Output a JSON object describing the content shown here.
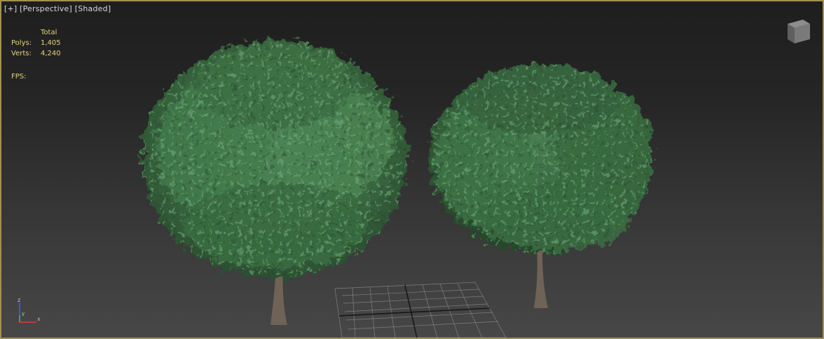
{
  "viewport": {
    "labels": [
      "[+]",
      "[Perspective]",
      "[Shaded]"
    ],
    "accent_border": "#a39052"
  },
  "stats": {
    "header": "Total",
    "polys_label": "Polys:",
    "polys_value": "1,405",
    "verts_label": "Verts:",
    "verts_value": "4,240",
    "fps_label": "FPS:",
    "text_color": "#e8d37a"
  },
  "axis": {
    "z": "z",
    "y": "y",
    "x": "x"
  },
  "icons": {
    "viewcube": "viewcube-icon",
    "axis": "axis-tripod-icon",
    "grid": "home-grid"
  },
  "scene_colors": {
    "foliage_dark": "#2f5a35",
    "foliage_mid": "#3f7346",
    "foliage_light": "#6da779",
    "trunk": "#6f6257",
    "grid_line": "#8a8a8a"
  }
}
